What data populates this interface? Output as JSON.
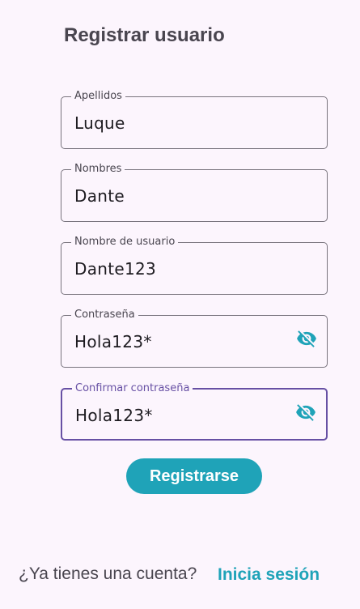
{
  "page": {
    "title": "Registrar usuario"
  },
  "form": {
    "fields": [
      {
        "label": "Apellidos",
        "value": "Luque"
      },
      {
        "label": "Nombres",
        "value": "Dante"
      },
      {
        "label": "Nombre de usuario",
        "value": "Dante123"
      },
      {
        "label": "Contraseña",
        "value": "Hola123*",
        "icon": "visibility-off-icon"
      },
      {
        "label": "Confirmar contraseña",
        "value": "Hola123*",
        "icon": "visibility-off-icon",
        "focused": true
      }
    ],
    "submit_label": "Registrarse"
  },
  "footer": {
    "prompt": "¿Ya tienes una cuenta?",
    "link_label": "Inicia sesión"
  },
  "colors": {
    "background": "#fcf5fd",
    "accent": "#1fa3b8",
    "focus": "#6750a4",
    "outline": "#79747e"
  }
}
